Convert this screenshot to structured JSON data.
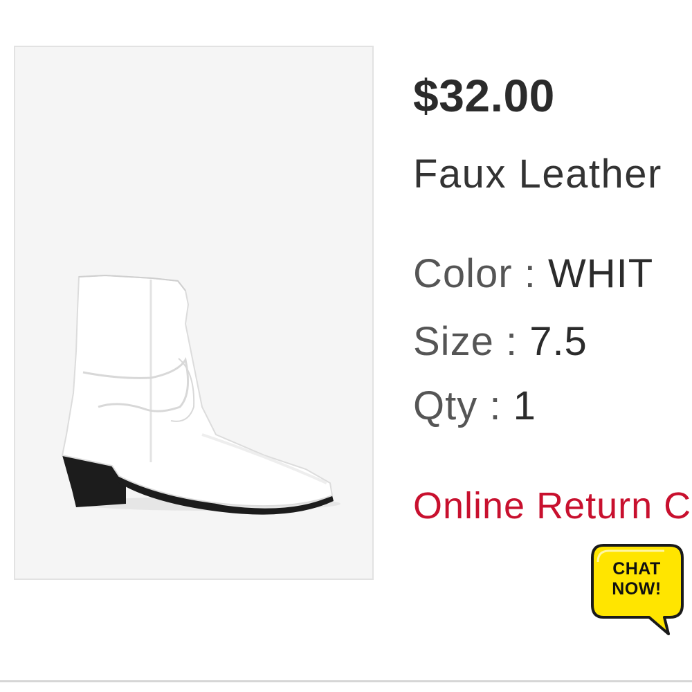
{
  "product": {
    "price": "$32.00",
    "name": "Faux Leather",
    "attributes": {
      "color_label": "Color",
      "color_value": "WHIT",
      "size_label": "Size",
      "size_value": "7.5",
      "qty_label": "Qty",
      "qty_value": "1",
      "separator": ":"
    },
    "return_link": "Online Return C",
    "image_icon": "white-cowboy-ankle-boot"
  },
  "chat": {
    "label": "CHAT NOW!",
    "bubble_color": "#ffe500",
    "icon": "speech-bubble-icon"
  },
  "colors": {
    "accent_red": "#c8102e",
    "price_text": "#2b2b2b",
    "image_bg": "#f5f5f5"
  }
}
